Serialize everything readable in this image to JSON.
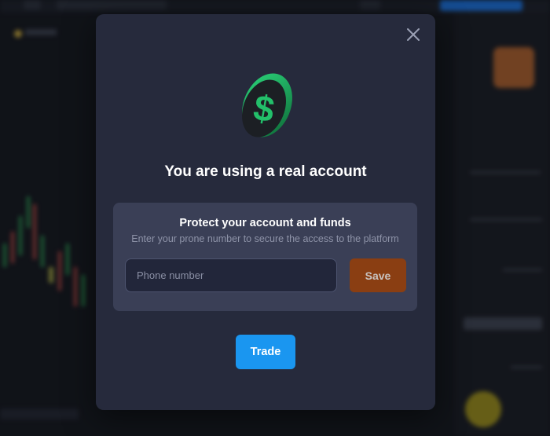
{
  "modal": {
    "title": "You are using a real account",
    "close_icon": "close-icon",
    "hero_icon": "dollar-coin-icon",
    "protect": {
      "title": "Protect your account and funds",
      "subtitle": "Enter your prone number to secure the access to the platform",
      "phone_placeholder": "Phone number",
      "phone_value": "",
      "save_label": "Save"
    },
    "trade_label": "Trade"
  },
  "colors": {
    "modal_bg": "#262a3c",
    "panel_bg": "#3a3f56",
    "save_button": "#8a3e12",
    "trade_button": "#1a96f0",
    "coin_accent": "#1fa35a"
  }
}
